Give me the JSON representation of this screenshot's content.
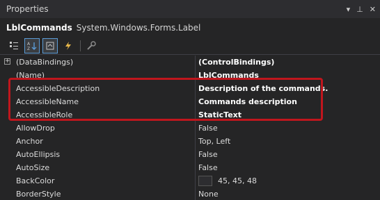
{
  "window": {
    "title": "Properties"
  },
  "object": {
    "name": "LblCommands",
    "type": "System.Windows.Forms.Label"
  },
  "toolbar": {
    "categorized_icon": "categorized-icon",
    "alphabetical_icon": "alphabetical-icon",
    "properties_icon": "properties-icon",
    "events_icon": "events-icon",
    "pages_icon": "property-pages-icon"
  },
  "properties": [
    {
      "name": "(DataBindings)",
      "value": "(ControlBindings)",
      "bold": true,
      "expandable": true
    },
    {
      "name": "(Name)",
      "value": "LblCommands",
      "bold": true
    },
    {
      "name": "AccessibleDescription",
      "value": "Description of the commands.",
      "bold": true
    },
    {
      "name": "AccessibleName",
      "value": "Commands description",
      "bold": true
    },
    {
      "name": "AccessibleRole",
      "value": "StaticText",
      "bold": true
    },
    {
      "name": "AllowDrop",
      "value": "False"
    },
    {
      "name": "Anchor",
      "value": "Top, Left"
    },
    {
      "name": "AutoEllipsis",
      "value": "False"
    },
    {
      "name": "AutoSize",
      "value": "False"
    },
    {
      "name": "BackColor",
      "value": "45, 45, 48",
      "swatch": "#2d2d30"
    },
    {
      "name": "BorderStyle",
      "value": "None"
    }
  ],
  "colors": {
    "highlight": "#c0161d",
    "accent": "#5b9bd5"
  }
}
